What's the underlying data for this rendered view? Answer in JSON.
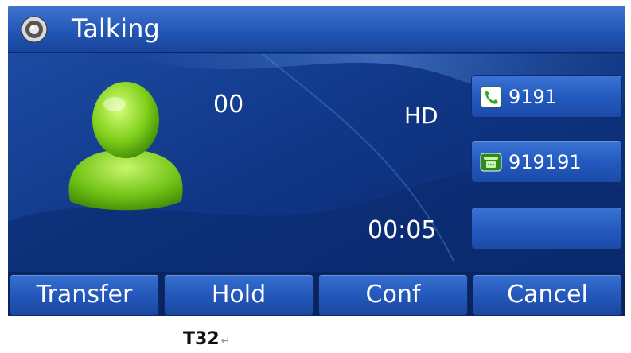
{
  "title_bar": {
    "title": "Talking",
    "icon": "speaker-icon"
  },
  "call": {
    "number": "00",
    "hd_label": "HD",
    "duration": "00:05",
    "avatar_icon": "contact-avatar-icon"
  },
  "line_keys": [
    {
      "label": "9191",
      "icon": "phone-active-icon"
    },
    {
      "label": "919191",
      "icon": "phone-idle-icon"
    },
    {
      "label": ""
    }
  ],
  "softkeys": [
    "Transfer",
    "Hold",
    "Conf",
    "Cancel"
  ],
  "caption": {
    "text": "T32",
    "return_mark": "↵"
  },
  "colors": {
    "screen_bg": "#0e2f80",
    "title_bar": "#2356b6",
    "key_blue": "#245bc0",
    "avatar_green": "#7fcf1a"
  }
}
